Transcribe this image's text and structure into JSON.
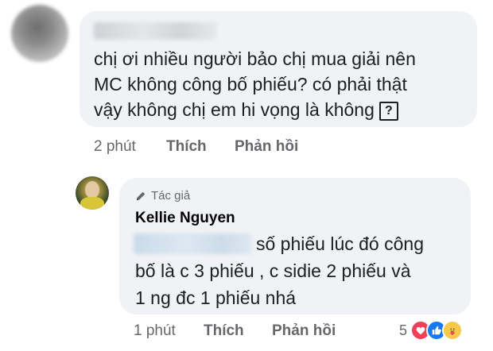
{
  "comment": {
    "text_lines": [
      "chị ơi nhiều người bảo chị mua giải nên",
      "MC không công bố phiếu? có phải thật",
      "vậy không chị em hi vọng là không"
    ],
    "q_box": "?",
    "time": "2 phút",
    "like_label": "Thích",
    "reply_label": "Phản hồi"
  },
  "reply": {
    "author_badge": "Tác giả",
    "author_name": "Kellie Nguyen",
    "text_lines": [
      "số phiếu lúc đó công",
      "bố là c 3 phiếu , c sidie 2 phiếu và",
      "1 ng đc 1 phiếu nhá"
    ],
    "time": "1 phút",
    "like_label": "Thích",
    "reply_label": "Phản hồi",
    "reaction_count": "5"
  },
  "icons": [
    "pencil-icon",
    "love-reaction-icon",
    "like-reaction-icon",
    "care-reaction-icon"
  ],
  "colors": {
    "bubble": "#f0f2f5",
    "meta_text": "#65676b",
    "love": "#f33e58",
    "like": "#1877f2",
    "care": "#f7c94a"
  }
}
